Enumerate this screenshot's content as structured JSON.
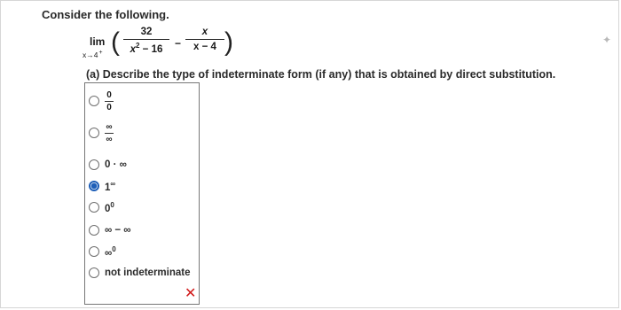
{
  "heading": "Consider the following.",
  "expression": {
    "lim": "lim",
    "approach": "x→4",
    "approach_side": "+",
    "term1": {
      "numerator": "32",
      "denominator_base": "x",
      "denominator_exp": "2",
      "denominator_rest": " − 16"
    },
    "term2": {
      "numerator": "x",
      "denominator": "x − 4"
    },
    "operator": "−"
  },
  "question": "(a) Describe the type of indeterminate form (if any) that is obtained by direct substitution.",
  "options": [
    {
      "id": "zero_over_zero",
      "num": "0",
      "den": "0",
      "selected": false
    },
    {
      "id": "inf_over_inf",
      "num": "∞",
      "den": "∞",
      "selected": false
    },
    {
      "id": "zero_times_inf",
      "label": "0 · ∞",
      "selected": false
    },
    {
      "id": "one_to_inf",
      "base": "1",
      "exp": "∞",
      "selected": true
    },
    {
      "id": "zero_to_zero",
      "base": "0",
      "exp": "0",
      "selected": false
    },
    {
      "id": "inf_minus_inf",
      "label": "∞ − ∞",
      "selected": false
    },
    {
      "id": "inf_to_zero",
      "base": "∞",
      "exp": "0",
      "selected": false
    },
    {
      "id": "not_indeterminate",
      "label": "not indeterminate",
      "selected": false
    }
  ],
  "feedback": {
    "mark": "✕",
    "status": "incorrect",
    "color": "#d11a1a"
  },
  "icons": {
    "corner": "puzzle-icon",
    "feedback": "x-mark-icon"
  }
}
